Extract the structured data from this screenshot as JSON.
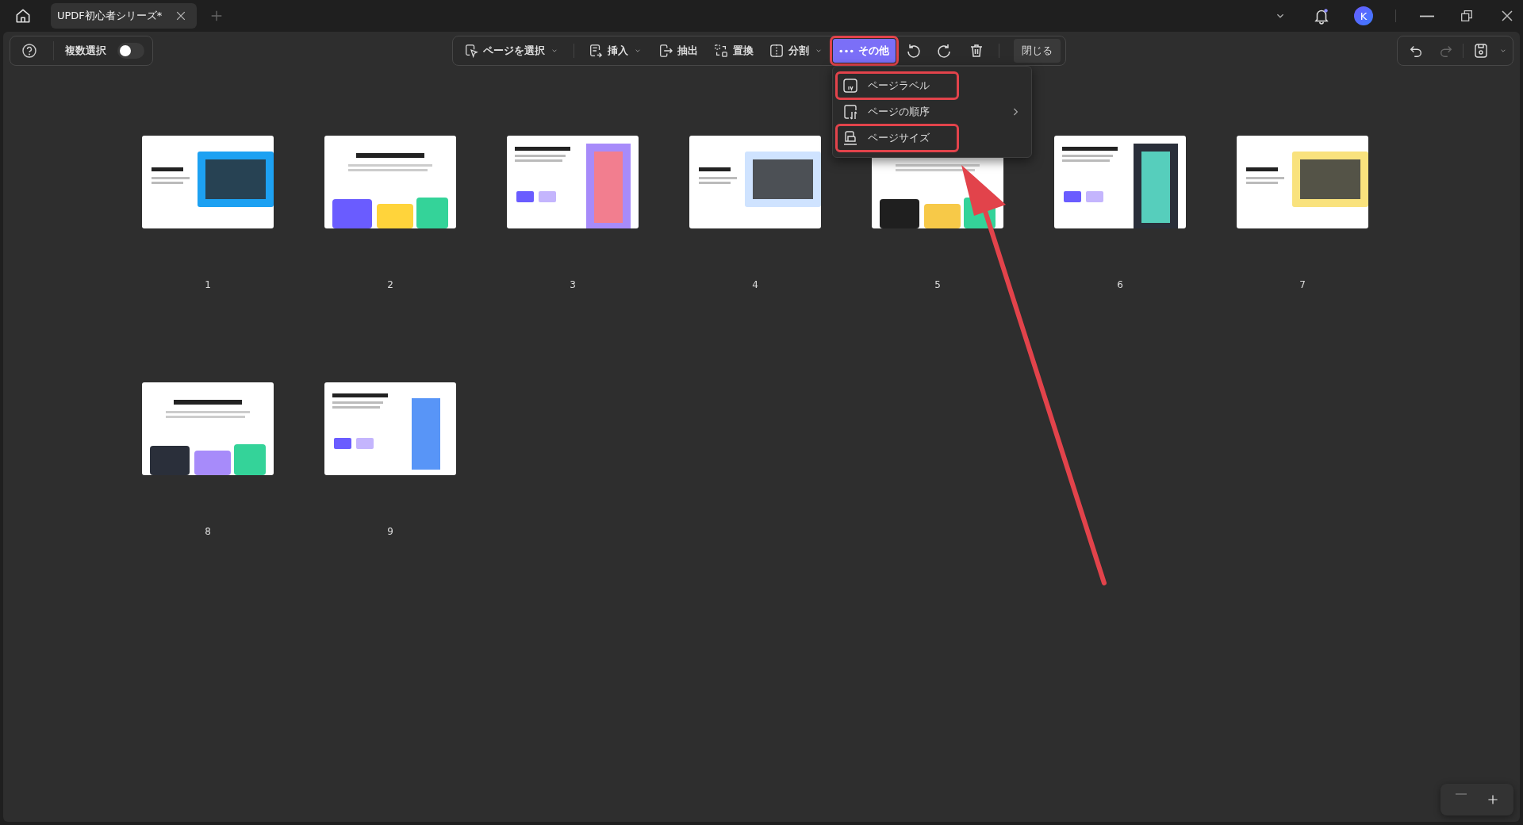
{
  "tabs": [
    {
      "label": "UPDF初心者シリーズ*",
      "selected": true
    }
  ],
  "account": {
    "initial": "K"
  },
  "multi_select": {
    "label": "複数選択",
    "on": false
  },
  "toolbar": [
    {
      "label": "ページを選択",
      "dropdown": true,
      "selected": false,
      "highlighted": false
    },
    {
      "label": "挿入",
      "dropdown": true,
      "selected": false,
      "highlighted": false
    },
    {
      "label": "抽出",
      "dropdown": false,
      "selected": false,
      "highlighted": false
    },
    {
      "label": "置換",
      "dropdown": false,
      "selected": false,
      "highlighted": false
    },
    {
      "label": "分割",
      "dropdown": true,
      "selected": false,
      "highlighted": false
    },
    {
      "label": "その他",
      "dropdown": false,
      "selected": true,
      "highlighted": true
    }
  ],
  "close_button": "閉じる",
  "menu": [
    {
      "label": "ページラベル",
      "submenu": false,
      "highlighted": true
    },
    {
      "label": "ページの順序",
      "submenu": true,
      "highlighted": false
    },
    {
      "label": "ページサイズ",
      "submenu": false,
      "highlighted": true
    }
  ],
  "pages": [
    {
      "label": "1"
    },
    {
      "label": "2"
    },
    {
      "label": "3"
    },
    {
      "label": "4"
    },
    {
      "label": "5"
    },
    {
      "label": "6"
    },
    {
      "label": "7"
    },
    {
      "label": "8"
    },
    {
      "label": "9"
    }
  ]
}
